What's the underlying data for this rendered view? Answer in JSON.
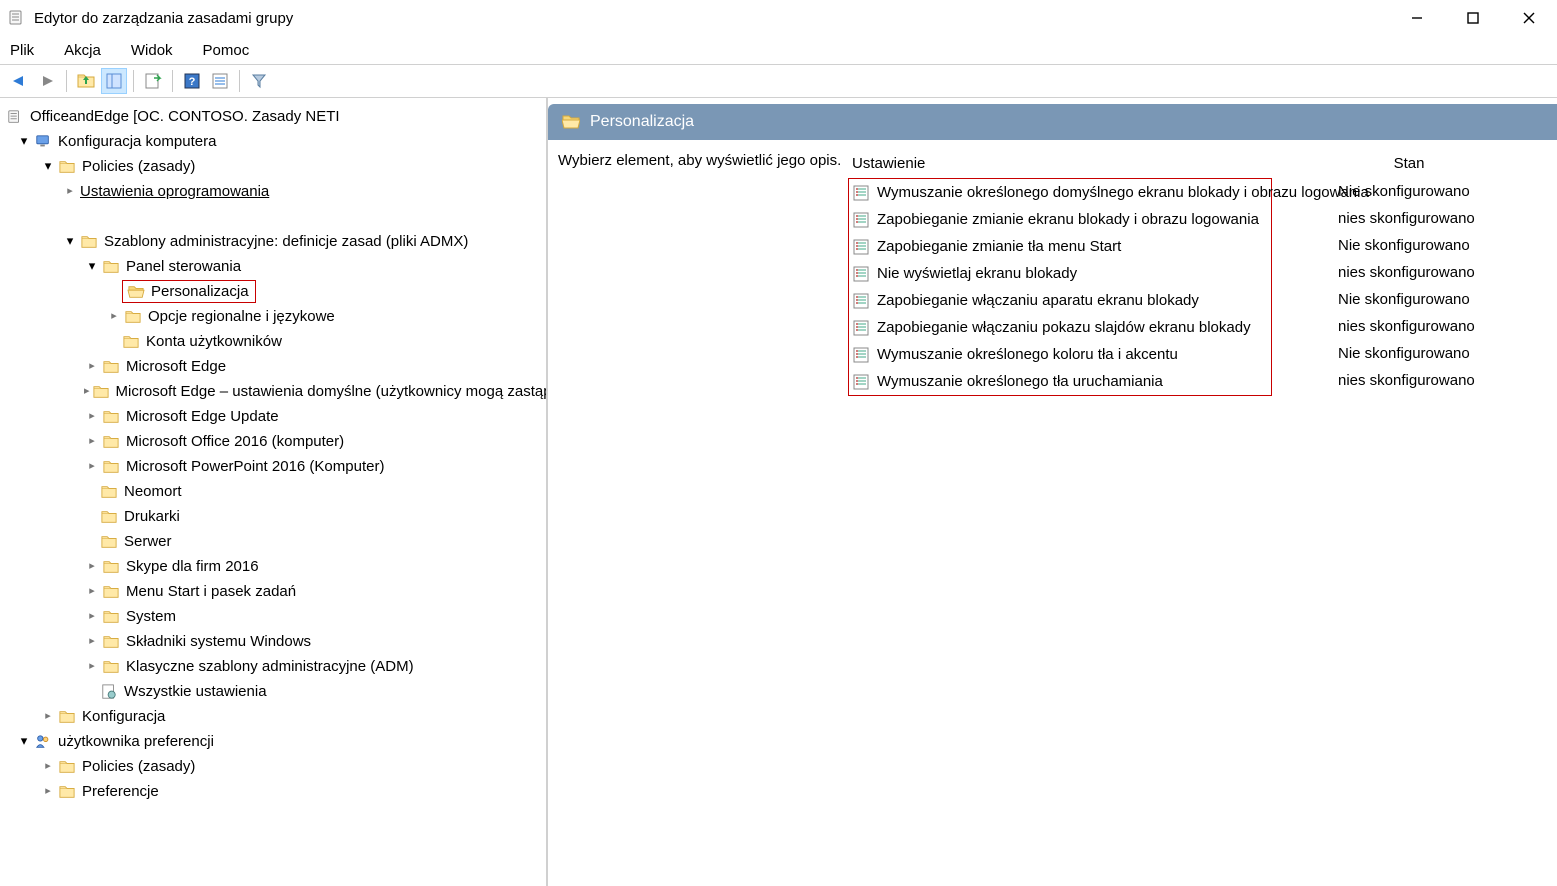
{
  "window": {
    "title": "Edytor do zarządzania zasadami grupy"
  },
  "menu": {
    "file": "Plik",
    "action": "Akcja",
    "view": "Widok",
    "help": "Pomoc"
  },
  "tree": {
    "root": "OfficeandEdge [OC. CONTOSO. Zasady NETI",
    "computer_config": "Konfiguracja komputera",
    "policies": "Policies (zasady)",
    "software_settings": "Ustawienia oprogramowania",
    "admin_templates": "Szablony administracyjne: definicje zasad (pliki ADMX)",
    "control_panel": "Panel sterowania",
    "personalization": "Personalizacja",
    "regional": "Opcje regionalne i językowe",
    "user_accounts": "Konta użytkowników",
    "edge": "Microsoft Edge",
    "edge_default": "Microsoft Edge – ustawienia domyślne (użytkownicy mogą zastąpić)",
    "edge_update": "Microsoft Edge Update",
    "office2016": "Microsoft Office 2016 (komputer)",
    "ppt2016": "Microsoft PowerPoint 2016 (Komputer)",
    "neomort": "Neomort",
    "printers": "Drukarki",
    "server": "Serwer",
    "skype": "Skype dla firm 2016",
    "startmenu": "Menu Start i pasek zadań",
    "system": "System",
    "windows_components": "Składniki systemu Windows",
    "classic_adm": "Klasyczne szablony administracyjne (ADM)",
    "all_settings": "Wszystkie ustawienia",
    "configuration": "Konfiguracja",
    "user_pref": "użytkownika preferencji",
    "policies2": "Policies (zasady)",
    "preferences": "Preferencje"
  },
  "right": {
    "header": "Personalizacja",
    "hint": "Wybierz element, aby wyświetlić jego opis.",
    "col_setting": "Ustawienie",
    "col_state": "Stan",
    "rows": [
      {
        "label": "Wymuszanie określonego domyślnego ekranu blokady i obrazu logowania",
        "state": "Nie skonfigurowano"
      },
      {
        "label": "Zapobieganie zmianie ekranu blokady i obrazu logowania",
        "state": "nies skonfigurowano"
      },
      {
        "label": "Zapobieganie zmianie tła menu Start",
        "state": "Nie skonfigurowano"
      },
      {
        "label": "Nie wyświetlaj ekranu blokady",
        "state": "nies skonfigurowano"
      },
      {
        "label": "Zapobieganie włączaniu aparatu ekranu blokady",
        "state": "Nie skonfigurowano"
      },
      {
        "label": "Zapobieganie włączaniu pokazu slajdów ekranu blokady",
        "state": "nies skonfigurowano"
      },
      {
        "label": "Wymuszanie określonego koloru tła i akcentu",
        "state": "Nie skonfigurowano"
      },
      {
        "label": "Wymuszanie określonego tła uruchamiania",
        "state": "nies skonfigurowano"
      }
    ]
  }
}
